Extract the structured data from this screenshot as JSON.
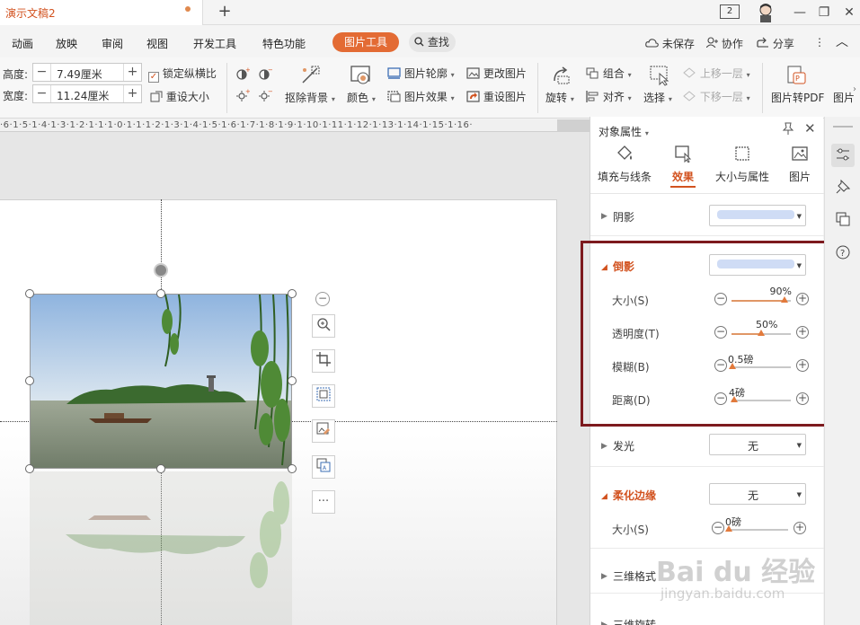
{
  "titlebar": {
    "doc_title": "演示文稿2",
    "new_tab": "+",
    "window_count": "2",
    "minimize": "—",
    "restore": "❐",
    "close": "✕"
  },
  "menubar": {
    "items": [
      "动画",
      "放映",
      "审阅",
      "视图",
      "开发工具",
      "特色功能"
    ],
    "active_tab": "图片工具",
    "search_label": "查找",
    "unsaved": "未保存",
    "collaborate": "协作",
    "share": "分享",
    "more": "⋮",
    "collapse": "︿",
    "accent_color": "#e36b34"
  },
  "ribbon": {
    "height_label": "高度:",
    "height_value": "7.49厘米",
    "width_label": "宽度:",
    "width_value": "11.24厘米",
    "lock_ratio": "锁定纵横比",
    "reset_size": "重设大小",
    "remove_bg": "抠除背景",
    "color": "颜色",
    "pic_outline": "图片轮廓",
    "pic_effect": "图片效果",
    "change_pic": "更改图片",
    "reset_pic": "重设图片",
    "rotate": "旋转",
    "group": "组合",
    "align": "对齐",
    "select": "选择",
    "bring_forward": "上移一层",
    "send_backward": "下移一层",
    "pic_to_pdf": "图片转PDF",
    "pic_more": "图片"
  },
  "ruler": {
    "text": "·6·1·5·1·4·1·3·1·2·1·1·1·0·1·1·1·2·1·3·1·4·1·5·1·6·1·7·1·8·1·9·1·10·1·11·1·12·1·13·1·14·1·15·1·16·"
  },
  "float_toolbar": {
    "collapse": "−",
    "more": "···"
  },
  "pane": {
    "title": "对象属性",
    "tabs": [
      {
        "label": "填充与线条"
      },
      {
        "label": "效果"
      },
      {
        "label": "大小与属性"
      },
      {
        "label": "图片"
      }
    ],
    "shadow": {
      "label": "阴影"
    },
    "reflection": {
      "label": "倒影",
      "props": [
        {
          "label": "大小(S)",
          "value": "90%",
          "level": 0.9
        },
        {
          "label": "透明度(T)",
          "value": "50%",
          "level": 0.5
        },
        {
          "label": "模糊(B)",
          "value": "0.5磅",
          "level": 0.02
        },
        {
          "label": "距离(D)",
          "value": "4磅",
          "level": 0.04
        }
      ]
    },
    "glow": {
      "label": "发光",
      "value": "无"
    },
    "soft_edge": {
      "label": "柔化边缘",
      "value": "无",
      "size_label": "大小(S)",
      "size_value": "0磅",
      "size_level": 0.0
    },
    "three_d_format": {
      "label": "三维格式"
    },
    "three_d_rotate": {
      "label": "三维旋转"
    },
    "minus": "−",
    "plus": "+"
  },
  "sidebar": {
    "icons": [
      "properties-icon",
      "pin-icon",
      "duplicate-icon",
      "help-icon"
    ]
  },
  "watermark": {
    "text": "Bai du 经验",
    "sub": "jingyan.baidu.com"
  }
}
